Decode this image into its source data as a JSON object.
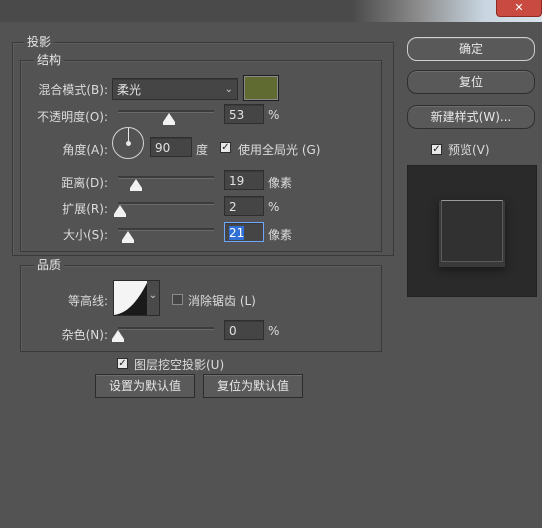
{
  "window": {
    "close_glyph": "✕"
  },
  "shadow_group": {
    "title": "投影"
  },
  "structure": {
    "title": "结构",
    "blend_mode": {
      "label": "混合模式(B):",
      "value": "柔光",
      "swatch_color": "#606b32"
    },
    "opacity": {
      "label": "不透明度(O):",
      "value": "53",
      "unit": "%",
      "level_percent": 53
    },
    "angle": {
      "label": "角度(A):",
      "value": "90",
      "unit": "度",
      "global_light_label": "使用全局光 (G)",
      "global_light_checked": true
    },
    "distance": {
      "label": "距离(D):",
      "value": "19",
      "unit": "像素",
      "level_percent": 19
    },
    "spread": {
      "label": "扩展(R):",
      "value": "2",
      "unit": "%",
      "level_percent": 2
    },
    "size": {
      "label": "大小(S):",
      "value": "21",
      "unit": "像素",
      "level_percent": 10
    }
  },
  "quality": {
    "title": "品质",
    "contour_label": "等高线:",
    "antialias_label": "消除锯齿 (L)",
    "antialias_checked": false,
    "noise": {
      "label": "杂色(N):",
      "value": "0",
      "unit": "%",
      "level_percent": 0
    }
  },
  "knockout": {
    "label": "图层挖空投影(U)",
    "checked": true
  },
  "buttons": {
    "make_default": "设置为默认值",
    "reset_default": "复位为默认值",
    "ok": "确定",
    "reset": "复位",
    "new_style": "新建样式(W)...",
    "preview_label": "预览(V)",
    "preview_checked": true
  },
  "icons": {
    "check": "✓",
    "dropdown": "chevron-down-icon"
  }
}
